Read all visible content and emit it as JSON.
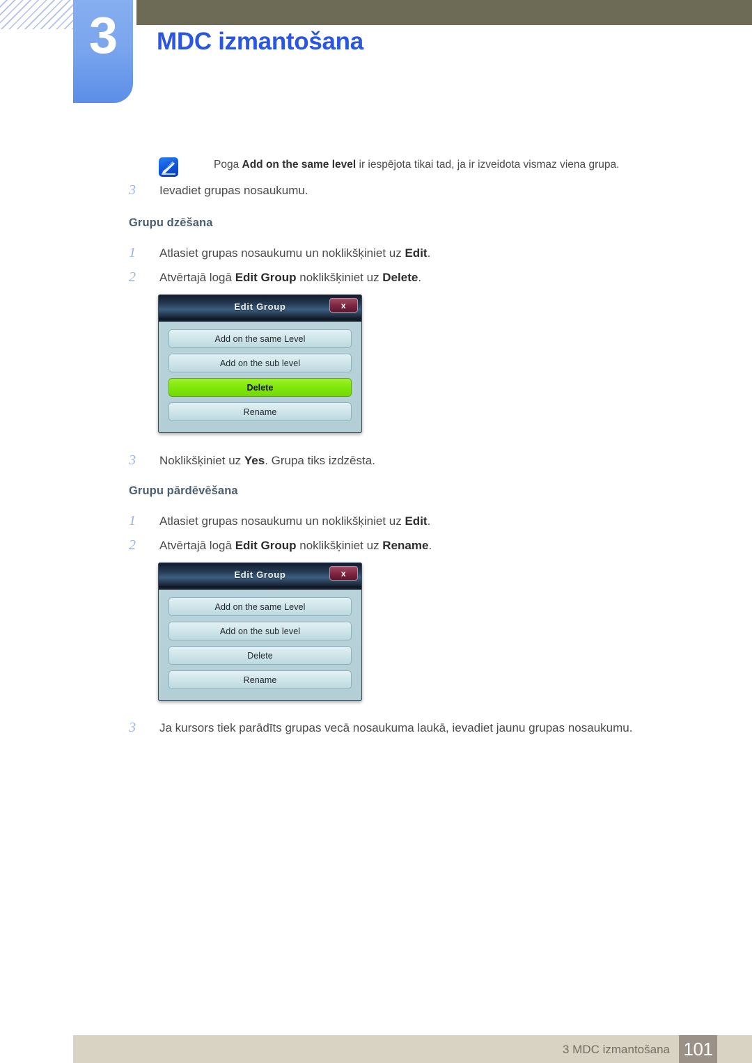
{
  "header": {
    "chapter_number": "3",
    "chapter_title": "MDC izmantošana",
    "accent_blue": "#2b57e0",
    "tab_blue": "#7ba6ee",
    "olive": "#6d6b55"
  },
  "note": {
    "icon": "note-pen-icon",
    "text_before": "Poga ",
    "bold_1": "Add on the same level",
    "text_after": " ir iespējota tikai tad, ja ir izveidota vismaz viena grupa."
  },
  "steps": {
    "intro_step_3": {
      "n": "3",
      "text": "Ievadiet grupas nosaukumu."
    },
    "delete_heading": "Grupu dzēšana",
    "delete_1": {
      "n": "1",
      "pre": "Atlasiet grupas nosaukumu un noklikšķiniet uz ",
      "bold": "Edit",
      "post": "."
    },
    "delete_2": {
      "n": "2",
      "pre": "Atvērtajā logā ",
      "bold": "Edit Group",
      "mid": " noklikšķiniet uz ",
      "bold2": "Delete",
      "post": "."
    },
    "delete_3": {
      "n": "3",
      "pre": "Noklikšķiniet uz ",
      "bold": "Yes",
      "post": ". Grupa tiks izdzēsta."
    },
    "rename_heading": "Grupu pārdēvēšana",
    "rename_1": {
      "n": "1",
      "pre": "Atlasiet grupas nosaukumu un noklikšķiniet uz ",
      "bold": "Edit",
      "post": "."
    },
    "rename_2": {
      "n": "2",
      "pre": "Atvērtajā logā ",
      "bold": "Edit Group",
      "mid": " noklikšķiniet uz ",
      "bold2": "Rename",
      "post": "."
    },
    "rename_3": {
      "n": "3",
      "text": "Ja kursors tiek parādīts grupas vecā nosaukuma laukā, ievadiet jaunu grupas nosaukumu."
    }
  },
  "dialog_delete": {
    "title": "Edit Group",
    "close_label": "x",
    "buttons": [
      {
        "label": "Add on the same Level",
        "highlighted": false
      },
      {
        "label": "Add on the sub level",
        "highlighted": false
      },
      {
        "label": "Delete",
        "highlighted": true
      },
      {
        "label": "Rename",
        "highlighted": false
      }
    ],
    "highlight_color": "#7fe70a"
  },
  "dialog_rename": {
    "title": "Edit Group",
    "close_label": "x",
    "buttons": [
      {
        "label": "Add on the same Level",
        "highlighted": false
      },
      {
        "label": "Add on the sub level",
        "highlighted": false
      },
      {
        "label": "Delete",
        "highlighted": false
      },
      {
        "label": "Rename",
        "highlighted": false
      }
    ]
  },
  "footer": {
    "label": "3 MDC izmantošana",
    "page_number": "101",
    "bar_color": "#d8d3c2",
    "page_box_color": "#9c9186"
  }
}
